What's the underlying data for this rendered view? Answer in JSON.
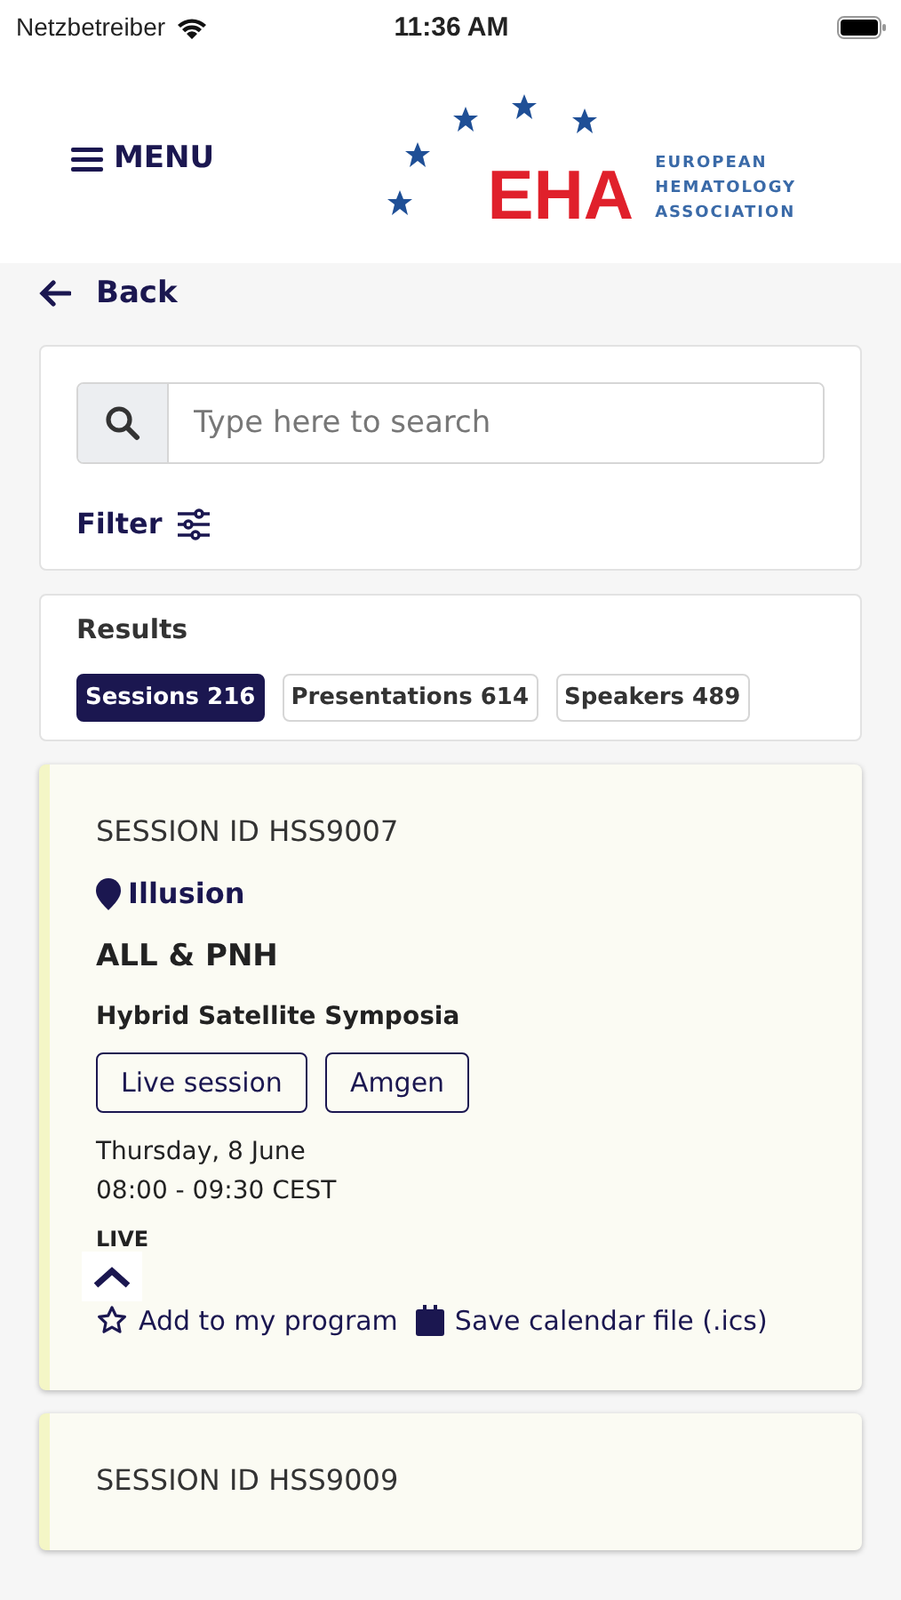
{
  "status_bar": {
    "carrier": "Netzbetreiber",
    "time": "11:36 AM"
  },
  "header": {
    "menu": "MENU",
    "logo": {
      "letters": "EHA",
      "lines": [
        "EUROPEAN",
        "HEMATOLOGY",
        "ASSOCIATION"
      ]
    }
  },
  "back": "Back",
  "search": {
    "placeholder": "Type here to search"
  },
  "filter": "Filter",
  "results": {
    "title": "Results",
    "tabs": [
      {
        "label": "Sessions 216",
        "selected": true
      },
      {
        "label": "Presentations 614",
        "selected": false
      },
      {
        "label": "Speakers 489",
        "selected": false
      }
    ]
  },
  "sessions": [
    {
      "id": "SESSION ID HSS9007",
      "location": "Illusion",
      "title": "ALL & PNH",
      "type": "Hybrid Satellite Symposia",
      "tags": [
        "Live session",
        "Amgen"
      ],
      "date": "Thursday, 8 June",
      "time": "08:00 - 09:30 CEST",
      "status": "LIVE",
      "actions": [
        "Add to my program",
        "Save calendar file (.ics)"
      ]
    },
    {
      "id": "SESSION ID HSS9009"
    }
  ]
}
